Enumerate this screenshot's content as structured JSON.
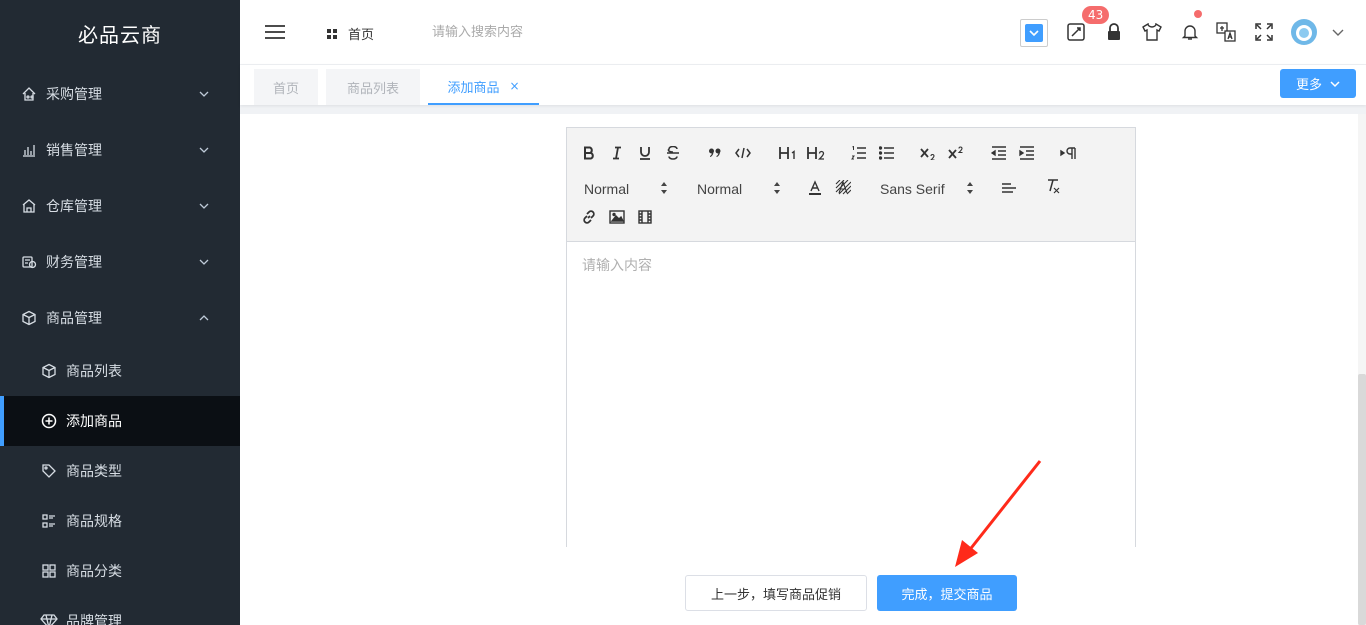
{
  "app": {
    "title": "必品云商"
  },
  "sidebar": {
    "menus": [
      {
        "label": "采购管理",
        "icon": "home-cart-icon",
        "expanded": false
      },
      {
        "label": "销售管理",
        "icon": "bar-chart-icon",
        "expanded": false
      },
      {
        "label": "仓库管理",
        "icon": "warehouse-icon",
        "expanded": false
      },
      {
        "label": "财务管理",
        "icon": "finance-icon",
        "expanded": false
      },
      {
        "label": "商品管理",
        "icon": "box-icon",
        "expanded": true
      }
    ],
    "sub_items": [
      {
        "label": "商品列表",
        "icon": "cube-icon",
        "active": false
      },
      {
        "label": "添加商品",
        "icon": "plus-circle-icon",
        "active": true
      },
      {
        "label": "商品类型",
        "icon": "tag-icon",
        "active": false
      },
      {
        "label": "商品规格",
        "icon": "spec-list-icon",
        "active": false
      },
      {
        "label": "商品分类",
        "icon": "grid-icon",
        "active": false
      },
      {
        "label": "品牌管理",
        "icon": "diamond-icon",
        "active": false
      }
    ]
  },
  "header": {
    "home_label": "首页",
    "search_placeholder": "请输入搜索内容",
    "badge_count": "43"
  },
  "tabs": [
    {
      "label": "首页",
      "active": false
    },
    {
      "label": "商品列表",
      "active": false
    },
    {
      "label": "添加商品",
      "active": true,
      "close": "×"
    }
  ],
  "more_button": "更多",
  "editor": {
    "toolbar": {
      "header_picker": "Normal",
      "size_picker": "Normal",
      "font_picker": "Sans Serif"
    },
    "placeholder": "请输入内容"
  },
  "footer": {
    "prev_label": "上一步，填写商品促销",
    "submit_label": "完成，提交商品"
  },
  "colors": {
    "primary": "#409eff",
    "sidebar_bg": "#222a33",
    "badge": "#f56c6c",
    "annotation": "#ff2a1a"
  }
}
